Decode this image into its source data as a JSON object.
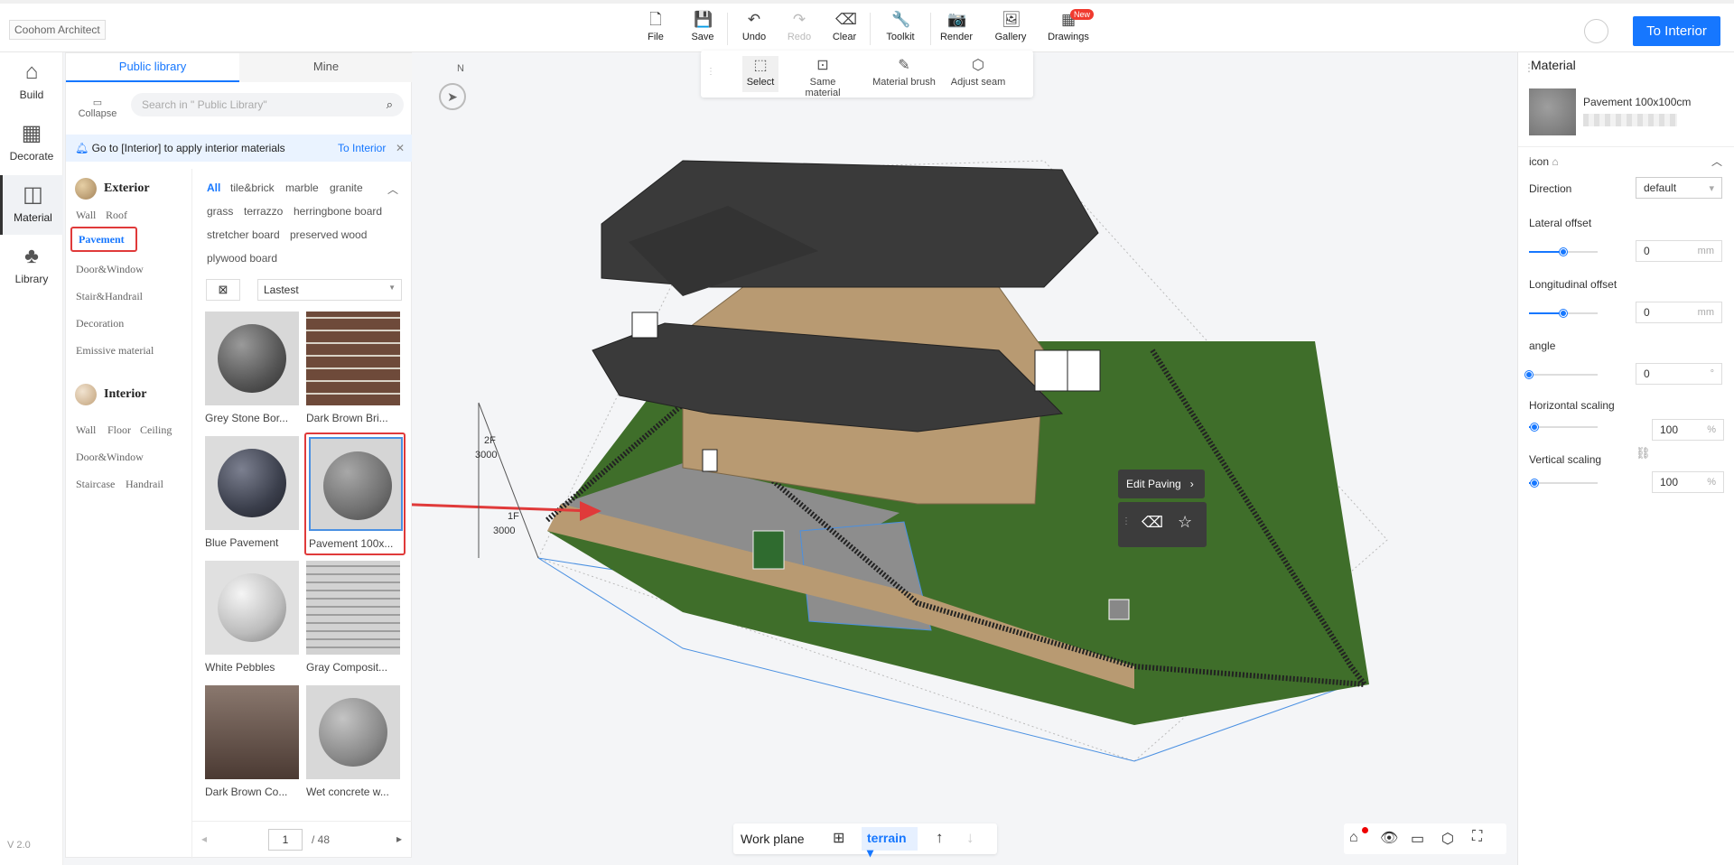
{
  "app": {
    "brand": "Coohom Architect",
    "version": "V 2.0",
    "to_interior_label": "To Interior",
    "new_badge": "New"
  },
  "toolbar": {
    "file": "File",
    "save": "Save",
    "undo": "Undo",
    "redo": "Redo",
    "clear": "Clear",
    "toolkit": "Toolkit",
    "render": "Render",
    "gallery": "Gallery",
    "drawings": "Drawings"
  },
  "rail": {
    "build": "Build",
    "decorate": "Decorate",
    "material": "Material",
    "library": "Library"
  },
  "library": {
    "tab_public": "Public library",
    "tab_mine": "Mine",
    "collapse": "Collapse",
    "search_placeholder": "Search in \" Public Library\"",
    "notice": "Go to [Interior] to apply interior materials",
    "notice_link": "To Interior",
    "exterior": {
      "title": "Exterior",
      "wall": "Wall",
      "roof": "Roof",
      "pavement": "Pavement",
      "door_window": "Door&Window",
      "stair_handrail": "Stair&Handrail",
      "decoration": "Decoration",
      "emissive": "Emissive material"
    },
    "interior": {
      "title": "Interior",
      "wall": "Wall",
      "floor": "Floor",
      "ceiling": "Ceiling",
      "door_window": "Door&Window",
      "staircase": "Staircase",
      "handrail": "Handrail"
    },
    "filters": [
      "All",
      "tile&brick",
      "marble",
      "granite",
      "grass",
      "terrazzo",
      "herringbone board",
      "stretcher board",
      "preserved wood",
      "plywood board"
    ],
    "sort": "Lastest",
    "tiles": [
      "Grey Stone Bor...",
      "Dark Brown Bri...",
      "Blue Pavement",
      "Pavement 100x...",
      "White Pebbles",
      "Gray Composit...",
      "Dark Brown Co...",
      "Wet concrete w..."
    ],
    "page": "1",
    "page_total": "/ 48"
  },
  "subtoolbar": {
    "select": "Select",
    "same_material": "Same material",
    "material_brush": "Material brush",
    "adjust_seam": "Adjust seam"
  },
  "viewport": {
    "compass": "N",
    "level_2f": "2F",
    "level_2f_h": "3000",
    "level_1f": "1F",
    "level_1f_h": "3000",
    "edit_paving": "Edit Paving",
    "work_plane": "Work plane",
    "terrain": "terrain"
  },
  "material_panel": {
    "title": "Material",
    "material_name": "Pavement 100x100cm",
    "section": "icon",
    "direction_label": "Direction",
    "direction_value": "default",
    "lateral_label": "Lateral offset",
    "lateral_value": "0",
    "lateral_unit": "mm",
    "lateral_slider": 0.5,
    "longitudinal_label": "Longitudinal offset",
    "longitudinal_value": "0",
    "longitudinal_unit": "mm",
    "longitudinal_slider": 0.5,
    "angle_label": "angle",
    "angle_value": "0",
    "angle_unit": "°",
    "angle_slider": 0.0,
    "hscale_label": "Horizontal scaling",
    "hscale_value": "100",
    "hscale_unit": "%",
    "hscale_slider": 0.08,
    "vscale_label": "Vertical scaling",
    "vscale_value": "100",
    "vscale_unit": "%",
    "vscale_slider": 0.08
  }
}
